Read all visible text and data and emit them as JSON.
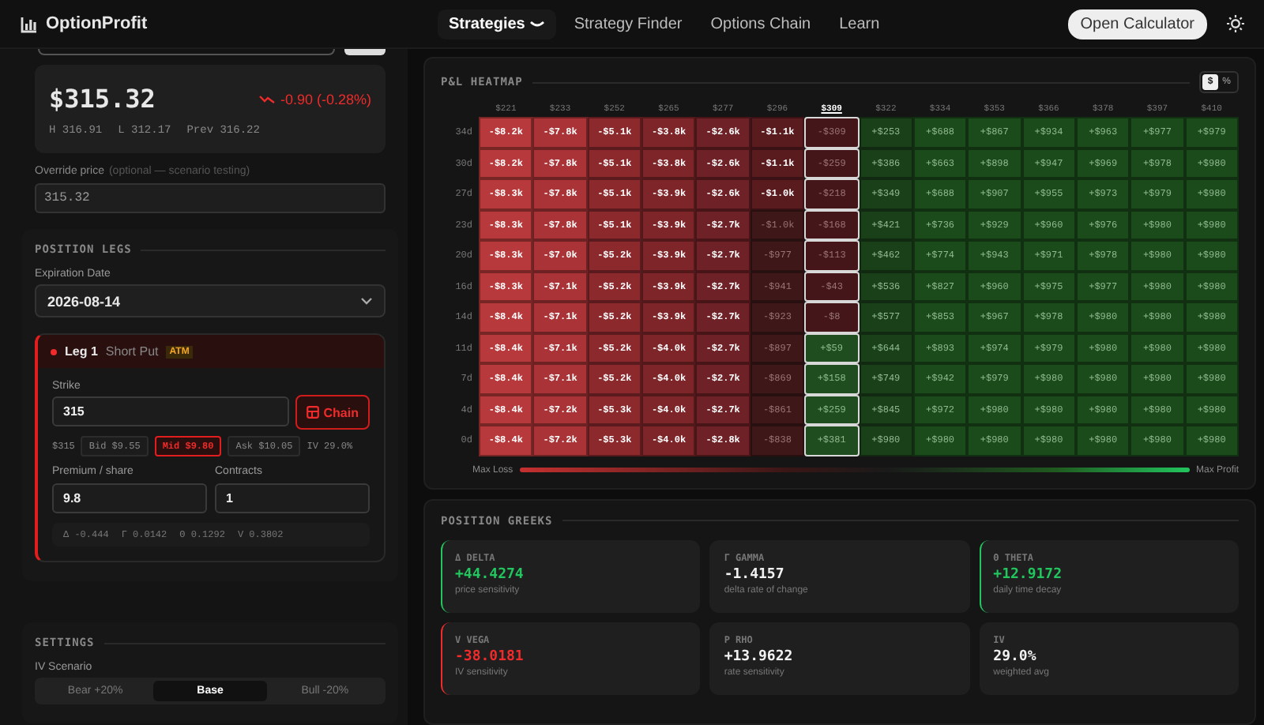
{
  "topbar": {
    "logo": "OptionProfit",
    "nav": [
      {
        "label": "Strategies",
        "selected": true,
        "caret": true
      },
      {
        "label": "Strategy Finder",
        "selected": false,
        "caret": false
      },
      {
        "label": "Options Chain",
        "selected": false,
        "caret": false
      },
      {
        "label": "Learn",
        "selected": false,
        "caret": false
      }
    ],
    "button": "Open Calculator"
  },
  "quote": {
    "price": "$315.32",
    "change": "-0.90 (-0.28%)",
    "stats": [
      "H 316.91",
      "L 312.17",
      "Prev 316.22"
    ]
  },
  "override": {
    "label": "Override price",
    "hint": "(optional — scenario testing)",
    "value": "315.32"
  },
  "legs": {
    "title": "POSITION LEGS",
    "expiration_label": "Expiration Date",
    "expiration": "2026-08-14",
    "leg": {
      "name": "Leg 1",
      "type": "Short Put",
      "badge": "ATM",
      "strike_label": "Strike",
      "strike": "315",
      "chain_button": "Chain",
      "spot": "$315",
      "quotes": [
        {
          "label": "Bid $9.55",
          "selected": false
        },
        {
          "label": "Mid $9.80",
          "selected": true
        },
        {
          "label": "Ask $10.05",
          "selected": false
        }
      ],
      "iv": "IV 29.0%",
      "premium_label": "Premium / share",
      "premium": "9.8",
      "contracts_label": "Contracts",
      "contracts": "1",
      "greeks": [
        "Δ -0.444",
        "Γ 0.0142",
        "Θ 0.1292",
        "V 0.3802"
      ]
    }
  },
  "settings": {
    "title": "SETTINGS",
    "iv_label": "IV Scenario",
    "options": [
      {
        "label": "Bear +20%",
        "selected": false
      },
      {
        "label": "Base",
        "selected": true
      },
      {
        "label": "Bull -20%",
        "selected": false
      }
    ]
  },
  "heatmap": {
    "title": "P&L HEATMAP",
    "units": [
      {
        "label": "$",
        "selected": true
      },
      {
        "label": "%",
        "selected": false
      }
    ],
    "columns": [
      {
        "label": "$221",
        "selected": false
      },
      {
        "label": "$233",
        "selected": false
      },
      {
        "label": "$252",
        "selected": false
      },
      {
        "label": "$265",
        "selected": false
      },
      {
        "label": "$277",
        "selected": false
      },
      {
        "label": "$296",
        "selected": false
      },
      {
        "label": "$309",
        "selected": true
      },
      {
        "label": "$322",
        "selected": false
      },
      {
        "label": "$334",
        "selected": false
      },
      {
        "label": "$353",
        "selected": false
      },
      {
        "label": "$366",
        "selected": false
      },
      {
        "label": "$378",
        "selected": false
      },
      {
        "label": "$397",
        "selected": false
      },
      {
        "label": "$410",
        "selected": false
      }
    ],
    "rows": [
      {
        "label": "34d",
        "cells": [
          {
            "text": "-$8.2k",
            "color": "#b8393b"
          },
          {
            "text": "-$7.8k",
            "color": "#a93336"
          },
          {
            "text": "-$5.1k",
            "color": "#8c292d"
          },
          {
            "text": "-$3.8k",
            "color": "#7e2529"
          },
          {
            "text": "-$2.6k",
            "color": "#6e2126"
          },
          {
            "text": "-$1.1k",
            "color": "#5a1b1f"
          },
          {
            "text": "-$309",
            "color": "#451619"
          },
          {
            "text": "+$253",
            "color": "#1a401a"
          },
          {
            "text": "+$688",
            "color": "#1b4a1b"
          },
          {
            "text": "+$867",
            "color": "#1b4a1b"
          },
          {
            "text": "+$934",
            "color": "#1b4a1b"
          },
          {
            "text": "+$963",
            "color": "#1b4a1b"
          },
          {
            "text": "+$977",
            "color": "#1b4a1b"
          },
          {
            "text": "+$979",
            "color": "#1b4a1b"
          }
        ]
      },
      {
        "label": "30d",
        "cells": [
          {
            "text": "-$8.2k",
            "color": "#b8393b"
          },
          {
            "text": "-$7.8k",
            "color": "#a93336"
          },
          {
            "text": "-$5.1k",
            "color": "#8c292d"
          },
          {
            "text": "-$3.8k",
            "color": "#7e2529"
          },
          {
            "text": "-$2.6k",
            "color": "#6e2126"
          },
          {
            "text": "-$1.1k",
            "color": "#5a1b1f"
          },
          {
            "text": "-$259",
            "color": "#451619"
          },
          {
            "text": "+$386",
            "color": "#1a401a"
          },
          {
            "text": "+$663",
            "color": "#1b4a1b"
          },
          {
            "text": "+$898",
            "color": "#1b4a1b"
          },
          {
            "text": "+$947",
            "color": "#1b4a1b"
          },
          {
            "text": "+$969",
            "color": "#1b4a1b"
          },
          {
            "text": "+$978",
            "color": "#1b4a1b"
          },
          {
            "text": "+$980",
            "color": "#1b4a1b"
          }
        ]
      },
      {
        "label": "27d",
        "cells": [
          {
            "text": "-$8.3k",
            "color": "#b8393b"
          },
          {
            "text": "-$7.8k",
            "color": "#a93336"
          },
          {
            "text": "-$5.1k",
            "color": "#8c292d"
          },
          {
            "text": "-$3.9k",
            "color": "#7e2529"
          },
          {
            "text": "-$2.6k",
            "color": "#6e2126"
          },
          {
            "text": "-$1.0k",
            "color": "#5a1b1f"
          },
          {
            "text": "-$218",
            "color": "#451619"
          },
          {
            "text": "+$349",
            "color": "#1a401a"
          },
          {
            "text": "+$688",
            "color": "#1b4a1b"
          },
          {
            "text": "+$907",
            "color": "#1b4a1b"
          },
          {
            "text": "+$955",
            "color": "#1b4a1b"
          },
          {
            "text": "+$973",
            "color": "#1b4a1b"
          },
          {
            "text": "+$979",
            "color": "#1b4a1b"
          },
          {
            "text": "+$980",
            "color": "#1b4a1b"
          }
        ]
      },
      {
        "label": "23d",
        "cells": [
          {
            "text": "-$8.3k",
            "color": "#b8393b"
          },
          {
            "text": "-$7.8k",
            "color": "#a93336"
          },
          {
            "text": "-$5.1k",
            "color": "#8c292d"
          },
          {
            "text": "-$3.9k",
            "color": "#7e2529"
          },
          {
            "text": "-$2.7k",
            "color": "#6e2126"
          },
          {
            "text": "-$1.0k",
            "color": "#3e1719"
          },
          {
            "text": "-$168",
            "color": "#451619"
          },
          {
            "text": "+$421",
            "color": "#1a401a"
          },
          {
            "text": "+$736",
            "color": "#1b4a1b"
          },
          {
            "text": "+$929",
            "color": "#1b4a1b"
          },
          {
            "text": "+$960",
            "color": "#1b4a1b"
          },
          {
            "text": "+$976",
            "color": "#1b4a1b"
          },
          {
            "text": "+$980",
            "color": "#1b4a1b"
          },
          {
            "text": "+$980",
            "color": "#1b4a1b"
          }
        ]
      },
      {
        "label": "20d",
        "cells": [
          {
            "text": "-$8.3k",
            "color": "#b8393b"
          },
          {
            "text": "-$7.0k",
            "color": "#a93336"
          },
          {
            "text": "-$5.2k",
            "color": "#8c292d"
          },
          {
            "text": "-$3.9k",
            "color": "#7e2529"
          },
          {
            "text": "-$2.7k",
            "color": "#6e2126"
          },
          {
            "text": "-$977",
            "color": "#3e1719"
          },
          {
            "text": "-$113",
            "color": "#451619"
          },
          {
            "text": "+$462",
            "color": "#1a401a"
          },
          {
            "text": "+$774",
            "color": "#1b4a1b"
          },
          {
            "text": "+$943",
            "color": "#1b4a1b"
          },
          {
            "text": "+$971",
            "color": "#1b4a1b"
          },
          {
            "text": "+$978",
            "color": "#1b4a1b"
          },
          {
            "text": "+$980",
            "color": "#1b4a1b"
          },
          {
            "text": "+$980",
            "color": "#1b4a1b"
          }
        ]
      },
      {
        "label": "16d",
        "cells": [
          {
            "text": "-$8.3k",
            "color": "#b8393b"
          },
          {
            "text": "-$7.1k",
            "color": "#a93336"
          },
          {
            "text": "-$5.2k",
            "color": "#8c292d"
          },
          {
            "text": "-$3.9k",
            "color": "#7e2529"
          },
          {
            "text": "-$2.7k",
            "color": "#6e2126"
          },
          {
            "text": "-$941",
            "color": "#3e1719"
          },
          {
            "text": "-$43",
            "color": "#451619"
          },
          {
            "text": "+$536",
            "color": "#1a401a"
          },
          {
            "text": "+$827",
            "color": "#1b4a1b"
          },
          {
            "text": "+$960",
            "color": "#1b4a1b"
          },
          {
            "text": "+$975",
            "color": "#1b4a1b"
          },
          {
            "text": "+$977",
            "color": "#1b4a1b"
          },
          {
            "text": "+$980",
            "color": "#1b4a1b"
          },
          {
            "text": "+$980",
            "color": "#1b4a1b"
          }
        ]
      },
      {
        "label": "14d",
        "cells": [
          {
            "text": "-$8.4k",
            "color": "#b8393b"
          },
          {
            "text": "-$7.1k",
            "color": "#a93336"
          },
          {
            "text": "-$5.2k",
            "color": "#8c292d"
          },
          {
            "text": "-$3.9k",
            "color": "#7e2529"
          },
          {
            "text": "-$2.7k",
            "color": "#6e2126"
          },
          {
            "text": "-$923",
            "color": "#3e1719"
          },
          {
            "text": "-$8",
            "color": "#451619"
          },
          {
            "text": "+$577",
            "color": "#1a401a"
          },
          {
            "text": "+$853",
            "color": "#1b4a1b"
          },
          {
            "text": "+$967",
            "color": "#1b4a1b"
          },
          {
            "text": "+$978",
            "color": "#1b4a1b"
          },
          {
            "text": "+$980",
            "color": "#1b4a1b"
          },
          {
            "text": "+$980",
            "color": "#1b4a1b"
          },
          {
            "text": "+$980",
            "color": "#1b4a1b"
          }
        ]
      },
      {
        "label": "11d",
        "cells": [
          {
            "text": "-$8.4k",
            "color": "#b8393b"
          },
          {
            "text": "-$7.1k",
            "color": "#a93336"
          },
          {
            "text": "-$5.2k",
            "color": "#8c292d"
          },
          {
            "text": "-$4.0k",
            "color": "#7e2529"
          },
          {
            "text": "-$2.7k",
            "color": "#6e2126"
          },
          {
            "text": "-$897",
            "color": "#3e1719"
          },
          {
            "text": "+$59",
            "color": "#1f4d1f"
          },
          {
            "text": "+$644",
            "color": "#1a401a"
          },
          {
            "text": "+$893",
            "color": "#1b4a1b"
          },
          {
            "text": "+$974",
            "color": "#1b4a1b"
          },
          {
            "text": "+$979",
            "color": "#1b4a1b"
          },
          {
            "text": "+$980",
            "color": "#1b4a1b"
          },
          {
            "text": "+$980",
            "color": "#1b4a1b"
          },
          {
            "text": "+$980",
            "color": "#1b4a1b"
          }
        ]
      },
      {
        "label": "7d",
        "cells": [
          {
            "text": "-$8.4k",
            "color": "#b8393b"
          },
          {
            "text": "-$7.1k",
            "color": "#a93336"
          },
          {
            "text": "-$5.2k",
            "color": "#8c292d"
          },
          {
            "text": "-$4.0k",
            "color": "#7e2529"
          },
          {
            "text": "-$2.7k",
            "color": "#6e2126"
          },
          {
            "text": "-$869",
            "color": "#3e1719"
          },
          {
            "text": "+$158",
            "color": "#1f4d1f"
          },
          {
            "text": "+$749",
            "color": "#1a401a"
          },
          {
            "text": "+$942",
            "color": "#1b4a1b"
          },
          {
            "text": "+$979",
            "color": "#1b4a1b"
          },
          {
            "text": "+$980",
            "color": "#1b4a1b"
          },
          {
            "text": "+$980",
            "color": "#1b4a1b"
          },
          {
            "text": "+$980",
            "color": "#1b4a1b"
          },
          {
            "text": "+$980",
            "color": "#1b4a1b"
          }
        ]
      },
      {
        "label": "4d",
        "cells": [
          {
            "text": "-$8.4k",
            "color": "#b8393b"
          },
          {
            "text": "-$7.2k",
            "color": "#a93336"
          },
          {
            "text": "-$5.3k",
            "color": "#8c292d"
          },
          {
            "text": "-$4.0k",
            "color": "#7e2529"
          },
          {
            "text": "-$2.7k",
            "color": "#6e2126"
          },
          {
            "text": "-$861",
            "color": "#3e1719"
          },
          {
            "text": "+$259",
            "color": "#1f4d1f"
          },
          {
            "text": "+$845",
            "color": "#1a401a"
          },
          {
            "text": "+$972",
            "color": "#1b4a1b"
          },
          {
            "text": "+$980",
            "color": "#1b4a1b"
          },
          {
            "text": "+$980",
            "color": "#1b4a1b"
          },
          {
            "text": "+$980",
            "color": "#1b4a1b"
          },
          {
            "text": "+$980",
            "color": "#1b4a1b"
          },
          {
            "text": "+$980",
            "color": "#1b4a1b"
          }
        ]
      },
      {
        "label": "0d",
        "cells": [
          {
            "text": "-$8.4k",
            "color": "#b8393b"
          },
          {
            "text": "-$7.2k",
            "color": "#a93336"
          },
          {
            "text": "-$5.3k",
            "color": "#8c292d"
          },
          {
            "text": "-$4.0k",
            "color": "#7e2529"
          },
          {
            "text": "-$2.8k",
            "color": "#6e2126"
          },
          {
            "text": "-$838",
            "color": "#3e1719"
          },
          {
            "text": "+$381",
            "color": "#1f4d1f"
          },
          {
            "text": "+$980",
            "color": "#1a401a"
          },
          {
            "text": "+$980",
            "color": "#1b4a1b"
          },
          {
            "text": "+$980",
            "color": "#1b4a1b"
          },
          {
            "text": "+$980",
            "color": "#1b4a1b"
          },
          {
            "text": "+$980",
            "color": "#1b4a1b"
          },
          {
            "text": "+$980",
            "color": "#1b4a1b"
          },
          {
            "text": "+$980",
            "color": "#1b4a1b"
          }
        ]
      }
    ],
    "legend": {
      "min": "Max Loss",
      "max": "Max Profit"
    }
  },
  "greeks": {
    "title": "POSITION GREEKS",
    "cards": [
      {
        "label": "Δ DELTA",
        "value": "+44.4274",
        "note": "price sensitivity",
        "color": "#22c55e",
        "accent": true
      },
      {
        "label": "Γ GAMMA",
        "value": "-1.4157",
        "note": "delta rate of change",
        "color": "#f2f2f2",
        "accent": false
      },
      {
        "label": "Θ THETA",
        "value": "+12.9172",
        "note": "daily time decay",
        "color": "#22c55e",
        "accent": true
      },
      {
        "label": "V VEGA",
        "value": "-38.0181",
        "note": "IV sensitivity",
        "color": "#ef2b2b",
        "accent": true
      },
      {
        "label": "Ρ RHO",
        "value": "+13.9622",
        "note": "rate sensitivity",
        "color": "#f2f2f2",
        "accent": false
      },
      {
        "label": "IV",
        "value": "29.0%",
        "note": "weighted avg",
        "color": "#f2f2f2",
        "accent": false
      }
    ]
  }
}
